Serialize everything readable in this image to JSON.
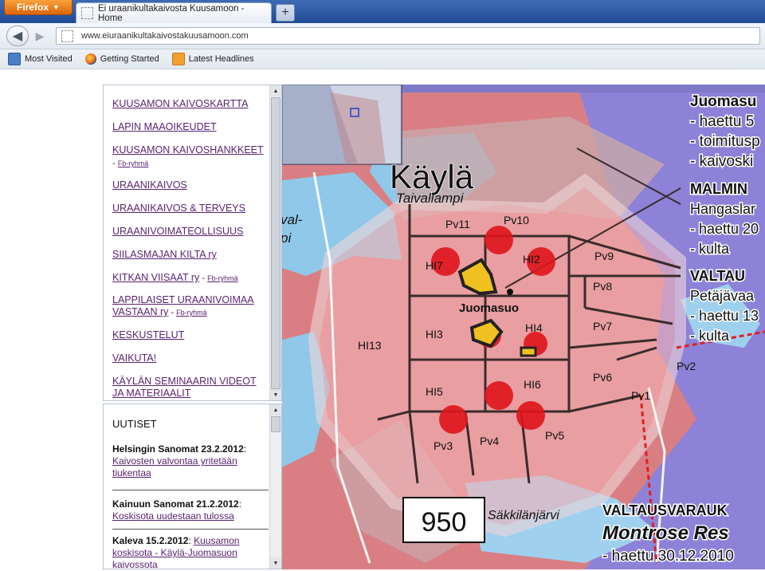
{
  "browser": {
    "menu_button": "Firefox",
    "tab_title": "Ei uraanikultakaivosta Kuusamoon - Home",
    "new_tab_symbol": "+",
    "url": "www.eiuraanikultakaivostakuusamoon.com",
    "bookmarks": [
      {
        "label": "Most Visited",
        "icon": "most-visited-icon"
      },
      {
        "label": "Getting Started",
        "icon": "firefox-icon"
      },
      {
        "label": "Latest Headlines",
        "icon": "rss-icon"
      }
    ]
  },
  "sidebar": {
    "menu": [
      {
        "label": "KUUSAMON KAIVOSKARTTA"
      },
      {
        "label": "LAPIN MAAOIKEUDET"
      },
      {
        "label": "KUUSAMON KAIVOSHANKKEET",
        "sub": "Fb-ryhmä"
      },
      {
        "label": "URAANIKAIVOS"
      },
      {
        "label": "URAANIKAIVOS & TERVEYS"
      },
      {
        "label": "URAANIVOIMATEOLLISUUS"
      },
      {
        "label": "SIILASMAJAN KILTA ry"
      },
      {
        "label": "KITKAN VIISAAT ry",
        "sub": "Fb-ryhmä"
      },
      {
        "label": "LAPPILAISET URAANIVOIMAA",
        "label2": "VASTAAN ry",
        "sub": "Fb-ryhmä"
      },
      {
        "label": "KESKUSTELUT"
      },
      {
        "label": "VAIKUTA!"
      },
      {
        "label": "KÄYLÄN SEMINAARIN VIDEOT",
        "label2": "JA MATERIAALIT"
      }
    ],
    "news_heading": "UUTISET",
    "news": [
      {
        "source": "Helsingin Sanomat 23.2.2012",
        "line1": "Kaivosten valvontaa yritetään",
        "line2": "tiukentaa"
      },
      {
        "source": "Kainuun Sanomat 21.2.2012",
        "line1": "Koskisota uudestaan tulossa"
      },
      {
        "source": "Kaleva 15.2.2012",
        "line1": "Kuusamon",
        "line2": "koskisota - Käylä-Juomasuon",
        "line3": "kaivossota"
      }
    ]
  },
  "map": {
    "place_title": "Käylä",
    "lake1": "Taivallampi",
    "town": "Juomasuo",
    "lake2": "Säkkilänjärvi",
    "edge_label": "val-",
    "edge_label2": "pi",
    "number_box": "950",
    "claims": [
      "Pv11",
      "Pv10",
      "HI7",
      "HI2",
      "Pv9",
      "Pv8",
      "HI3",
      "HI4",
      "Pv7",
      "HI13",
      "Pv6",
      "Pv2",
      "HI5",
      "HI6",
      "Pv1",
      "Pv3",
      "Pv4",
      "Pv5"
    ],
    "legend_top": [
      "Juomasu",
      "- haettu 5",
      "- toimitusp",
      "- kaivoski"
    ],
    "legend_mid": [
      "MALMIN",
      "Hangaslar",
      "- haettu 20",
      "- kulta"
    ],
    "legend_mid2": [
      "VALTAU",
      "Petäjävaa",
      "- haettu 13",
      "- kulta"
    ],
    "legend_bottom": [
      "VALTAUSVARAUK",
      "Montrose Res",
      "- haettu 30.12.2010"
    ]
  }
}
